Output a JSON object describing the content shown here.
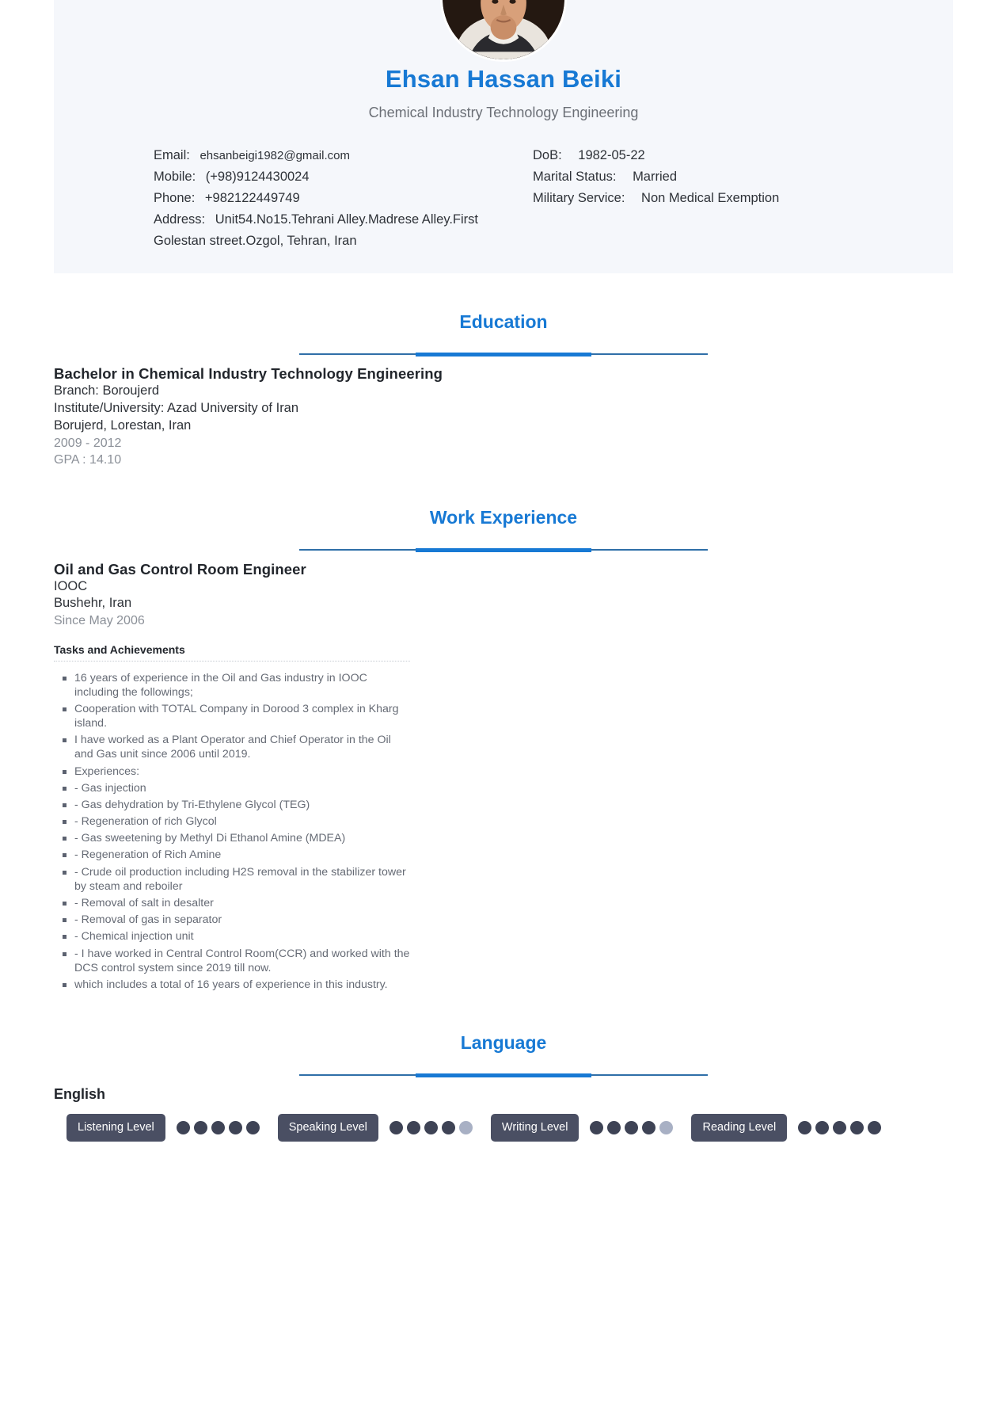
{
  "header": {
    "name": "Ehsan Hassan Beiki",
    "job_title": "Chemical Industry Technology Engineering",
    "avatar_alt": "profile-photo",
    "accent_color": "#1779d4",
    "band_color": "#f5f7fb",
    "left_details": [
      {
        "label": "Email:",
        "value": "ehsanbeigi1982@gmail.com"
      },
      {
        "label": "Mobile:",
        "value": "(+98)9124430024"
      },
      {
        "label": "Phone:",
        "value": "+982122449749"
      },
      {
        "label": "Address:",
        "value": "Unit54.No15.Tehrani Alley.Madrese Alley.First Golestan street.Ozgol, Tehran, Iran"
      }
    ],
    "right_details": [
      {
        "label": "DoB:",
        "value": "1982-05-22"
      },
      {
        "label": "Marital Status:",
        "value": "Married"
      },
      {
        "label": "Military Service:",
        "value": "Non Medical Exemption"
      }
    ]
  },
  "sections": {
    "education": {
      "heading": "Education",
      "entries": [
        {
          "degree": "Bachelor in Chemical Industry Technology Engineering",
          "branch": "Branch: Boroujerd",
          "institute": "Institute/University: Azad University of Iran",
          "location": "Borujerd, Lorestan, Iran",
          "dates": "2009 - 2012",
          "gpa": "GPA : 14.10"
        }
      ]
    },
    "work_experience": {
      "heading": "Work Experience",
      "entries": [
        {
          "role": "Oil and Gas Control Room Engineer",
          "company": "IOOC",
          "location": "Bushehr, Iran",
          "dates": "Since May 2006",
          "tasks_heading": "Tasks and Achievements",
          "tasks": [
            "16 years of experience in the Oil and Gas industry in IOOC including the followings;",
            "Cooperation with TOTAL Company in Dorood 3 complex in Kharg island.",
            "I have worked as a Plant Operator and Chief Operator in the Oil and Gas unit since 2006 until 2019.",
            "Experiences:",
            "- Gas injection",
            "- Gas dehydration by Tri-Ethylene Glycol (TEG)",
            "- Regeneration of rich Glycol",
            "- Gas sweetening by Methyl Di Ethanol Amine (MDEA)",
            "- Regeneration of Rich Amine",
            "- Crude oil production including H2S removal in the stabilizer tower by steam and reboiler",
            "- Removal of salt in desalter",
            "- Removal of gas in separator",
            "- Chemical injection unit",
            "- I have worked in Central Control Room(CCR) and worked with the DCS control system since 2019 till now.",
            "which includes a total of 16 years of experience in this industry."
          ]
        }
      ]
    },
    "language": {
      "heading": "Language",
      "languages": [
        {
          "name": "English",
          "skills": [
            {
              "label": "Listening Level",
              "filled": 5,
              "total": 5
            },
            {
              "label": "Speaking Level",
              "filled": 4,
              "total": 5
            },
            {
              "label": "Writing Level",
              "filled": 4,
              "total": 5
            },
            {
              "label": "Reading Level",
              "filled": 5,
              "total": 5
            }
          ]
        }
      ]
    }
  }
}
